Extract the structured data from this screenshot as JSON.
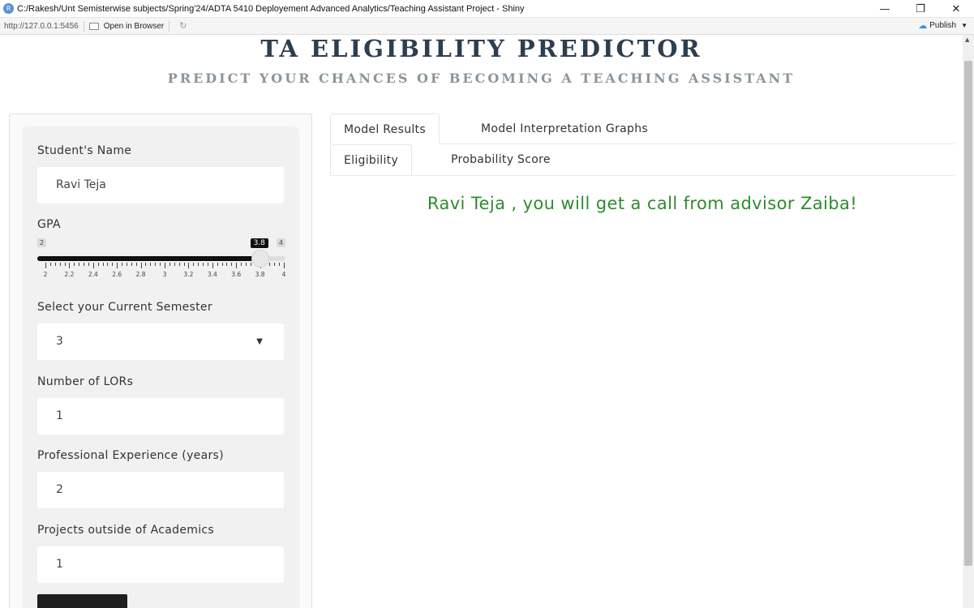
{
  "window": {
    "title": "C:/Rakesh/Unt Semisterwise subjects/Spring'24/ADTA 5410 Deployement Advanced Analytics/Teaching Assistant Project - Shiny",
    "app_icon": "R",
    "minimize": "—",
    "restore": "❐",
    "close": "✕"
  },
  "toolbar": {
    "url": "http://127.0.0.1:5456",
    "open_in_browser": "Open in Browser",
    "publish": "Publish"
  },
  "header": {
    "title": "TA ELIGIBILITY PREDICTOR",
    "subtitle": "PREDICT YOUR CHANCES OF BECOMING A TEACHING ASSISTANT"
  },
  "sidebar": {
    "name_label": "Student's Name",
    "name_value": "Ravi Teja",
    "gpa_label": "GPA",
    "gpa_min": "2",
    "gpa_max": "4",
    "gpa_value": "3.8",
    "gpa_fraction": 0.9,
    "gpa_ticks": [
      "2",
      "2.2",
      "2.4",
      "2.6",
      "2.8",
      "3",
      "3.2",
      "3.4",
      "3.6",
      "3.8",
      "4"
    ],
    "semester_label": "Select your Current Semester",
    "semester_value": "3",
    "lors_label": "Number of LORs",
    "lors_value": "1",
    "experience_label": "Professional Experience (years)",
    "experience_value": "2",
    "projects_label": "Projects outside of Academics",
    "projects_value": "1"
  },
  "main": {
    "tabs": [
      {
        "label": "Model Results"
      },
      {
        "label": "Model Interpretation Graphs"
      }
    ],
    "subtabs": [
      {
        "label": "Eligibility"
      },
      {
        "label": "Probability Score"
      }
    ],
    "result_message": "Ravi Teja , you will get a call from advisor Zaiba!",
    "result_color": "#2e8b2e"
  }
}
